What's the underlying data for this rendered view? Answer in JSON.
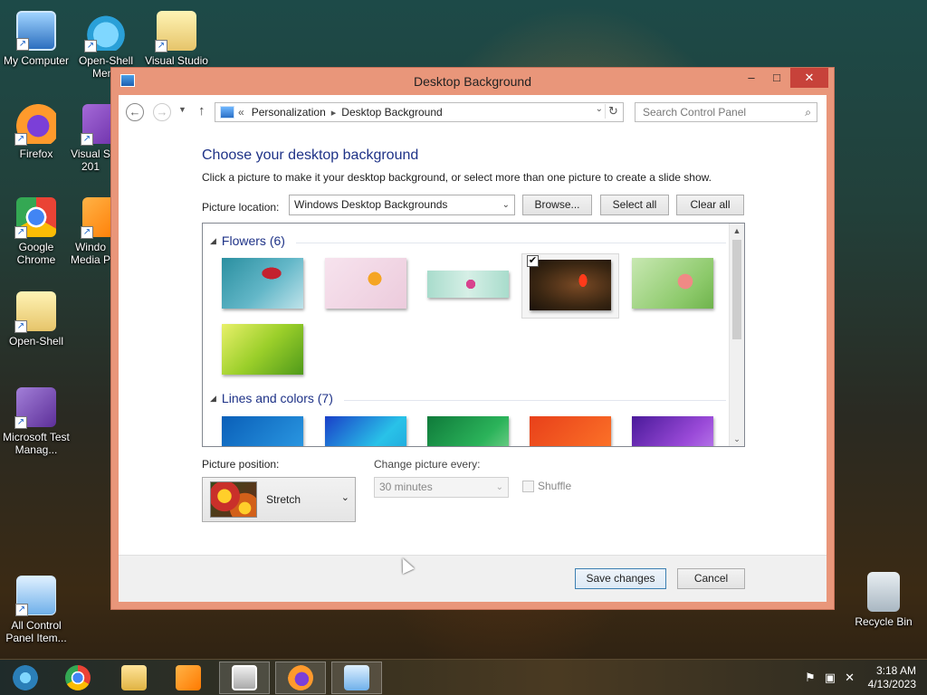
{
  "desktop": {
    "icons": [
      {
        "label": "My Computer"
      },
      {
        "label": "Open-Shell Menu"
      },
      {
        "label": "Visual Studio"
      },
      {
        "label": "Firefox"
      },
      {
        "label": "Visual S 201"
      },
      {
        "label": "Google Chrome"
      },
      {
        "label": "Windo Media P"
      },
      {
        "label": "Open-Shell"
      },
      {
        "label": "Microsoft Test Manag..."
      },
      {
        "label": "All Control Panel Item..."
      },
      {
        "label": "Recycle Bin"
      }
    ]
  },
  "window": {
    "title": "Desktop Background",
    "min_glyph": "–",
    "max_glyph": "□",
    "close_glyph": "✕",
    "nav": {
      "back_glyph": "←",
      "forward_glyph": "→",
      "recent_glyph": "▼",
      "up_glyph": "↑",
      "prefix": "«",
      "crumbs": [
        "Personalization",
        "Desktop Background"
      ],
      "crumb_sep": "▸",
      "dropdown_glyph": "⌄",
      "refresh_glyph": "↻",
      "search_placeholder": "Search Control Panel",
      "search_glyph": "⌕"
    },
    "heading": "Choose your desktop background",
    "subtext": "Click a picture to make it your desktop background, or select more than one picture to create a slide show.",
    "picture_location": {
      "label": "Picture location:",
      "value": "Windows Desktop Backgrounds",
      "caret": "⌄"
    },
    "buttons": {
      "browse": "Browse...",
      "select_all": "Select all",
      "clear_all": "Clear all",
      "save": "Save changes",
      "cancel": "Cancel"
    },
    "gallery": {
      "groups": [
        {
          "name": "Flowers (6)",
          "count": 6
        },
        {
          "name": "Lines and colors (7)",
          "count": 7
        }
      ],
      "tri_glyph": "◢",
      "selected_check": "✔",
      "selected_index": 3,
      "scroll_up": "▲",
      "scroll_down": "⌄"
    },
    "picture_position": {
      "label": "Picture position:",
      "value": "Stretch",
      "caret": "⌄"
    },
    "change_picture": {
      "label": "Change picture every:",
      "value": "30 minutes",
      "caret": "⌄"
    },
    "shuffle": {
      "label": "Shuffle",
      "checked": false
    }
  },
  "taskbar": {
    "tray_icons": [
      "flag-icon",
      "network-icon",
      "volume-muted-icon"
    ],
    "tray_glyphs": [
      "⚑",
      "▣",
      "✕"
    ],
    "time": "3:18 AM",
    "date": "4/13/2023"
  }
}
